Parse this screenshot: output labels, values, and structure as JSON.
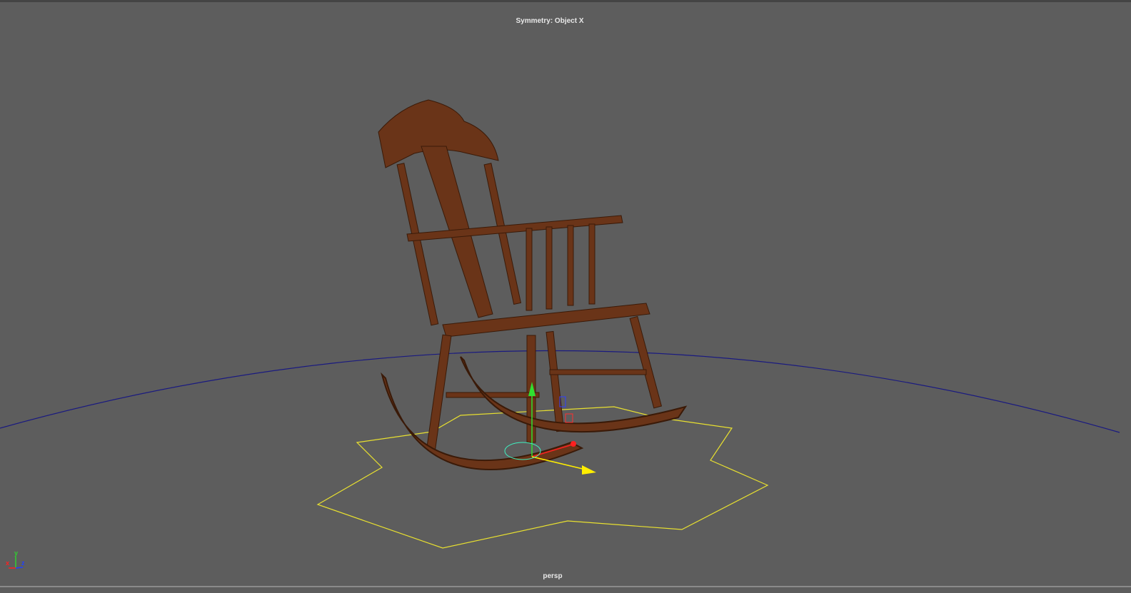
{
  "viewport": {
    "symmetry_label": "Symmetry: Object X",
    "camera_label": "persp",
    "background": "#5d5d5d"
  },
  "axis_gizmo": {
    "x": "x",
    "y": "y",
    "z": "z",
    "colors": {
      "x": "#ff2020",
      "y": "#30d030",
      "z": "#2040ff"
    }
  },
  "colors": {
    "horizon": "#1a1a80",
    "selection": "#e8e030",
    "wood": "#6a3418",
    "manip_y": "#30e030",
    "manip_x": "#ff2020",
    "manip_z": "#ffee00"
  }
}
